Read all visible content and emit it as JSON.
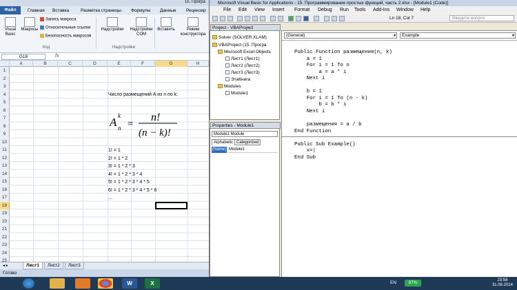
{
  "excel": {
    "title": "15. Програ",
    "file_tab": "Файл",
    "tabs": [
      "Главная",
      "Вставка",
      "Разметка страницы",
      "Формулы",
      "Данные",
      "Рецензир"
    ],
    "ribbon": {
      "visual_basic": "Visual Basic",
      "macros": "Макросы",
      "record_macro": "Запись макроса",
      "relative_refs": "Относительные ссылки",
      "macro_security": "Безопасность макросов",
      "group_code": "Код",
      "addins": "Надстройки",
      "com_addins": "Надстройки COM",
      "group_addins": "Надстройки",
      "insert": "Вставить",
      "design_mode": "Режим конструктора"
    },
    "name_box": "G18",
    "fx": "fx",
    "columns": [
      "A",
      "B",
      "C",
      "D",
      "E",
      "F",
      "G",
      "H"
    ],
    "rows": [
      "1",
      "2",
      "3",
      "4",
      "5",
      "6",
      "7",
      "8",
      "9",
      "10",
      "11",
      "12",
      "13",
      "14",
      "15",
      "16",
      "17",
      "18",
      "19",
      "20",
      "21",
      "22",
      "23",
      "24",
      "25"
    ],
    "cells": {
      "title": "Число размещений A из n по k:",
      "f11": "1! = 1",
      "f12": "2! = 1 * 2",
      "f13": "3! = 1 * 2 * 3",
      "f14": "4! = 1 * 2 * 3 * 4",
      "f15": "5! = 1 * 2 * 3 * 4 * 5",
      "f16": "6! = 1 * 2 * 3 * 4 * 5 * 6",
      "f17": "..."
    },
    "formula": {
      "A": "A",
      "n": "n",
      "k": "k",
      "eq": "=",
      "num": "n!",
      "den": "(n − k)!"
    },
    "sheets": [
      "Лист1",
      "Лист2",
      "Лист3"
    ],
    "status": "Готово"
  },
  "vba": {
    "title": "Microsoft Visual Basic for Applications - 15. Программирование простых функций, часть 2.xlsx - [Module1 (Code)]",
    "menu": [
      "File",
      "Edit",
      "View",
      "Insert",
      "Format",
      "Debug",
      "Run",
      "Tools",
      "Add-Ins",
      "Window",
      "Help"
    ],
    "position": "Ln 18, Col 7",
    "help_placeholder": "Введите вопрос",
    "project_title": "Project - VBAProject",
    "tree": [
      "Solver (SOLVER.XLAM)",
      "VBAProject (15. Програ",
      "Microsoft Excel Objects",
      "Лист1 (Лист1)",
      "Лист2 (Лист2)",
      "Лист3 (Лист3)",
      "ЭтаКнига",
      "Modules",
      "Module1"
    ],
    "props_title": "Properties - Module1",
    "props_combo": "Module1 Module",
    "props_tabs": [
      "Alphabetic",
      "Categorized"
    ],
    "prop_name": "(Name)",
    "prop_value": "Module1",
    "combo_object": "(General)",
    "combo_proc": "Example",
    "code": "Public Function размещения(n, k)\n    a = 1\n    For i = 1 To n\n        a = a * i\n    Next i\n\n    b = 1\n    For i = 1 To (n - k)\n        b = b * i\n    Next i\n\n    размещения = a / b\nEnd Function\n\nPublic Sub Example()\n    x=|\nEnd Sub"
  },
  "taskbar": {
    "language": "EN",
    "battery": "97%",
    "time": "23:58",
    "date": "31.08.2014",
    "apps": [
      "start",
      "explorer",
      "media",
      "chrome",
      "word",
      "excel"
    ]
  }
}
